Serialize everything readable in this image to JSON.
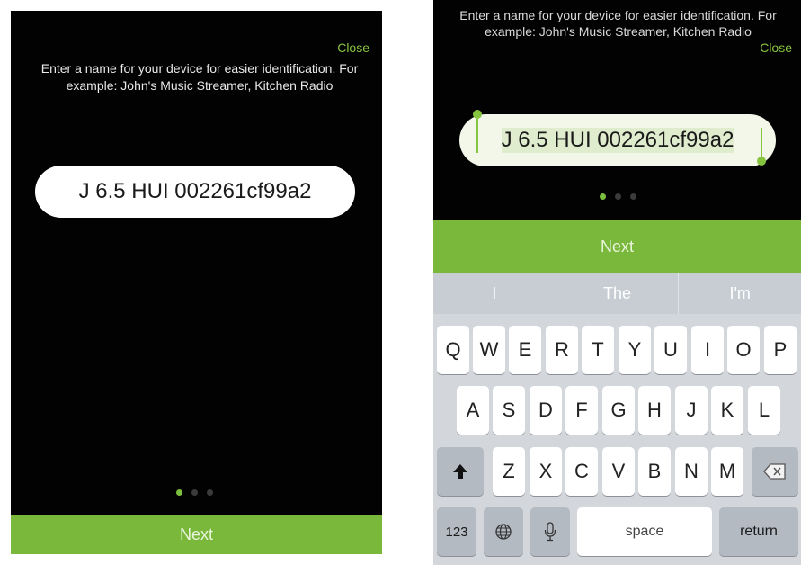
{
  "left": {
    "close_label": "Close",
    "instructions": "Enter a name for your device for easier identification. For example: John's Music Streamer, Kitchen Radio",
    "device_name": "J 6.5 HUI 002261cf99a2",
    "next_label": "Next",
    "page_dots": 3,
    "active_dot": 1
  },
  "right": {
    "close_label": "Close",
    "instructions": "Enter a name for your device for easier identification. For example: John's Music Streamer, Kitchen Radio",
    "device_name": "J 6.5 HUI 002261cf99a2",
    "next_label": "Next",
    "suggestions": [
      "I",
      "The",
      "I'm"
    ],
    "keyboard": {
      "row1": [
        "Q",
        "W",
        "E",
        "R",
        "T",
        "Y",
        "U",
        "I",
        "O",
        "P"
      ],
      "row2": [
        "A",
        "S",
        "D",
        "F",
        "G",
        "H",
        "J",
        "K",
        "L"
      ],
      "row3": [
        "Z",
        "X",
        "C",
        "V",
        "B",
        "N",
        "M"
      ],
      "numbers_label": "123",
      "space_label": "space",
      "return_label": "return",
      "shift_icon": "shift-arrow",
      "delete_icon": "backspace",
      "globe_icon": "globe",
      "mic_icon": "microphone"
    }
  },
  "colors": {
    "accent": "#7ab83c",
    "background": "#020202"
  }
}
